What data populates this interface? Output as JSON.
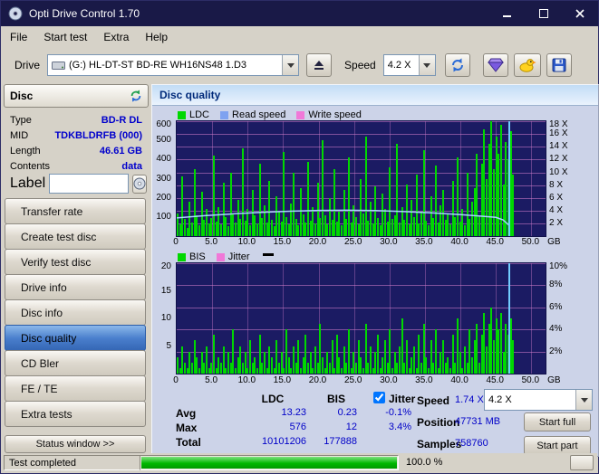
{
  "window": {
    "title": "Opti Drive Control 1.70"
  },
  "menu": [
    "File",
    "Start test",
    "Extra",
    "Help"
  ],
  "toolbar": {
    "drive_label": "Drive",
    "drive_value": "(G:)  HL-DT-ST BD-RE  WH16NS48 1.D3",
    "speed_label": "Speed",
    "speed_value": "4.2 X"
  },
  "sidebar": {
    "header": "Disc",
    "info": {
      "type_label": "Type",
      "type_value": "BD-R DL",
      "mid_label": "MID",
      "mid_value": "TDKBLDRFB (000)",
      "length_label": "Length",
      "length_value": "46.61 GB",
      "contents_label": "Contents",
      "contents_value": "data",
      "label_label": "Label",
      "label_value": ""
    },
    "buttons": [
      {
        "label": "Transfer rate"
      },
      {
        "label": "Create test disc"
      },
      {
        "label": "Verify test disc"
      },
      {
        "label": "Drive info"
      },
      {
        "label": "Disc info"
      },
      {
        "label": "Disc quality"
      },
      {
        "label": "CD Bler"
      },
      {
        "label": "FE / TE"
      },
      {
        "label": "Extra tests"
      }
    ],
    "selected_button": "Disc quality",
    "status_button": "Status window >>"
  },
  "main": {
    "header": "Disc quality",
    "legend_top": [
      {
        "label": "LDC",
        "color": "#00d800"
      },
      {
        "label": "Read speed",
        "color": "#7ea2f0"
      },
      {
        "label": "Write speed",
        "color": "#f078d8"
      }
    ],
    "legend_bottom": [
      {
        "label": "BIS",
        "color": "#00d800"
      },
      {
        "label": "Jitter",
        "color": "#f078d8"
      }
    ]
  },
  "stats": {
    "col_ldc": "LDC",
    "col_bis": "BIS",
    "jitter_label": "Jitter",
    "jitter_checked": true,
    "rows": [
      {
        "label": "Avg",
        "ldc": "13.23",
        "bis": "0.23",
        "jitter": "-0.1%"
      },
      {
        "label": "Max",
        "ldc": "576",
        "bis": "12",
        "jitter": "3.4%"
      },
      {
        "label": "Total",
        "ldc": "10101206",
        "bis": "177888",
        "jitter": ""
      }
    ],
    "speed_label": "Speed",
    "speed_value": "1.74 X",
    "position_label": "Position",
    "position_value": "47731 MB",
    "samples_label": "Samples",
    "samples_value": "758760",
    "speed_select": "4.2 X",
    "start_full": "Start full",
    "start_part": "Start part"
  },
  "statusbar": {
    "text": "Test completed",
    "percent": "100.0 %",
    "progress": 100
  },
  "chart_data": [
    {
      "type": "bar",
      "name": "LDC / Read speed",
      "ylim": [
        0,
        600
      ],
      "xlim_gb": [
        0,
        52
      ],
      "data_end_gb": 47.3,
      "cursor_gb": 46.8,
      "bar_color": "#00d800",
      "bg": "#1b1b63",
      "grid_color": "#d67ece",
      "left_ticks": [
        600,
        500,
        400,
        300,
        200,
        100
      ],
      "right_ticks": [
        {
          "label": "18 X",
          "val": 600
        },
        {
          "label": "16 X",
          "val": 533.3
        },
        {
          "label": "14 X",
          "val": 466.7
        },
        {
          "label": "12 X",
          "val": 400
        },
        {
          "label": "10 X",
          "val": 333.3
        },
        {
          "label": "8 X",
          "val": 266.7
        },
        {
          "label": "6 X",
          "val": 200
        },
        {
          "label": "4 X",
          "val": 133.3
        },
        {
          "label": "2 X",
          "val": 66.7
        }
      ],
      "grid_y": [
        600,
        533.3,
        466.7,
        400,
        333.3,
        266.7,
        200,
        133.3,
        66.7
      ],
      "grid_x_gb": [
        5,
        10,
        15,
        20,
        25,
        30,
        35,
        40,
        45,
        50
      ],
      "x_ticks": [
        {
          "gb": 0,
          "label": "0"
        },
        {
          "gb": 5,
          "label": "5.0"
        },
        {
          "gb": 10,
          "label": "10.0"
        },
        {
          "gb": 15,
          "label": "15.0"
        },
        {
          "gb": 20,
          "label": "20.0"
        },
        {
          "gb": 25,
          "label": "25.0"
        },
        {
          "gb": 30,
          "label": "30.0"
        },
        {
          "gb": 35,
          "label": "35.0"
        },
        {
          "gb": 40,
          "label": "40.0"
        },
        {
          "gb": 45,
          "label": "45.0"
        },
        {
          "gb": 50,
          "label": "50.0"
        }
      ],
      "x_unit": "GB",
      "bars": [
        120,
        60,
        310,
        90,
        45,
        180,
        70,
        350,
        110,
        55,
        230,
        85,
        140,
        65,
        95,
        420,
        75,
        150,
        60,
        280,
        100,
        50,
        330,
        120,
        70,
        190,
        90,
        460,
        80,
        140,
        55,
        240,
        110,
        65,
        380,
        95,
        160,
        70,
        290,
        85,
        50,
        210,
        130,
        75,
        440,
        100,
        60,
        170,
        330,
        90,
        55,
        250,
        115,
        70,
        390,
        80,
        150,
        65,
        280,
        95,
        500,
        110,
        60,
        200,
        85,
        350,
        75,
        130,
        55,
        240,
        90,
        410,
        70,
        160,
        100,
        60,
        300,
        120,
        520,
        80,
        180,
        65,
        260,
        95,
        55,
        220,
        140,
        75,
        360,
        90,
        110,
        480,
        70,
        150,
        85,
        270,
        60,
        190,
        100,
        320,
        65,
        130,
        450,
        80,
        55,
        210,
        95,
        370,
        70,
        160,
        240,
        85,
        120,
        60,
        290,
        100,
        410,
        75,
        140,
        55,
        330,
        90,
        180,
        250,
        430,
        110,
        380,
        560,
        300,
        480,
        600,
        350,
        520,
        430,
        580,
        270,
        490,
        400,
        550,
        320
      ],
      "curve": {
        "name": "Read speed",
        "color": "#a8d4ff",
        "x_gb": [
          0,
          4,
          8,
          12,
          16,
          20,
          24,
          28,
          32,
          36,
          40,
          43,
          45,
          46,
          46.8
        ],
        "vals": [
          95,
          107,
          116,
          124,
          130,
          134,
          135,
          133,
          128,
          121,
          112,
          104,
          98,
          85,
          58
        ]
      }
    },
    {
      "type": "bar",
      "name": "BIS / Jitter",
      "ylim": [
        0,
        20
      ],
      "xlim_gb": [
        0,
        52
      ],
      "data_end_gb": 47.3,
      "cursor_gb": 46.8,
      "bar_color": "#00d800",
      "bg": "#1b1b63",
      "grid_color": "#d67ece",
      "left_ticks": [
        20,
        15,
        10,
        5
      ],
      "right_ticks": [
        {
          "label": "10%",
          "val": 20
        },
        {
          "label": "8%",
          "val": 16
        },
        {
          "label": "6%",
          "val": 12
        },
        {
          "label": "4%",
          "val": 8
        },
        {
          "label": "2%",
          "val": 4
        }
      ],
      "grid_y": [
        20,
        16,
        12,
        8,
        4
      ],
      "grid_x_gb": [
        5,
        10,
        15,
        20,
        25,
        30,
        35,
        40,
        45,
        50
      ],
      "x_ticks": [
        {
          "gb": 0,
          "label": "0"
        },
        {
          "gb": 5,
          "label": "5.0"
        },
        {
          "gb": 10,
          "label": "10.0"
        },
        {
          "gb": 15,
          "label": "15.0"
        },
        {
          "gb": 20,
          "label": "20.0"
        },
        {
          "gb": 25,
          "label": "25.0"
        },
        {
          "gb": 30,
          "label": "30.0"
        },
        {
          "gb": 35,
          "label": "35.0"
        },
        {
          "gb": 40,
          "label": "40.0"
        },
        {
          "gb": 45,
          "label": "45.0"
        },
        {
          "gb": 50,
          "label": "50.0"
        }
      ],
      "x_unit": "GB",
      "bars": [
        3,
        1,
        5,
        2,
        1,
        4,
        2,
        6,
        3,
        1,
        4,
        2,
        5,
        1,
        2,
        7,
        1,
        3,
        2,
        5,
        1,
        4,
        2,
        8,
        1,
        3,
        5,
        2,
        4,
        1,
        6,
        2,
        3,
        1,
        7,
        2,
        4,
        1,
        5,
        3,
        1,
        6,
        2,
        4,
        1,
        8,
        3,
        1,
        5,
        2,
        6,
        1,
        3,
        7,
        2,
        4,
        1,
        5,
        2,
        9,
        3,
        1,
        4,
        2,
        6,
        1,
        7,
        3,
        1,
        5,
        2,
        8,
        1,
        4,
        2,
        6,
        3,
        1,
        9,
        2,
        5,
        1,
        4,
        7,
        1,
        3,
        6,
        2,
        8,
        1,
        4,
        2,
        5,
        10,
        2,
        6,
        1,
        3,
        5,
        1,
        7,
        2,
        9,
        3,
        1,
        6,
        2,
        8,
        1,
        4,
        6,
        2,
        3,
        1,
        7,
        2,
        10,
        4,
        1,
        5,
        2,
        8,
        3,
        6,
        9,
        2,
        7,
        11,
        5,
        9,
        12,
        6,
        10,
        8,
        11,
        4,
        9,
        7,
        10,
        6
      ]
    }
  ]
}
